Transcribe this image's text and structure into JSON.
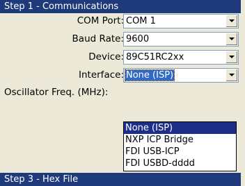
{
  "step1": {
    "title": "Step 1 - Communications"
  },
  "fields": [
    {
      "label": "COM Port:",
      "value": "COM 1"
    },
    {
      "label": "Baud Rate:",
      "value": "9600"
    },
    {
      "label": "Device:",
      "value": "89C51RC2xx"
    },
    {
      "label": "Interface:",
      "value": "None (ISP)"
    }
  ],
  "oscillator": {
    "label": "Oscillator Freq. (MHz):"
  },
  "interface_options": [
    "None (ISP)",
    "NXP ICP Bridge",
    "FDI USB-ICP",
    "FDI USBD-dddd"
  ],
  "step3": {
    "title": "Step 3 - Hex File"
  },
  "colors": {
    "header": "#1f3a7a",
    "highlight": "#1e2f8a",
    "panel": "#ece9d8"
  }
}
